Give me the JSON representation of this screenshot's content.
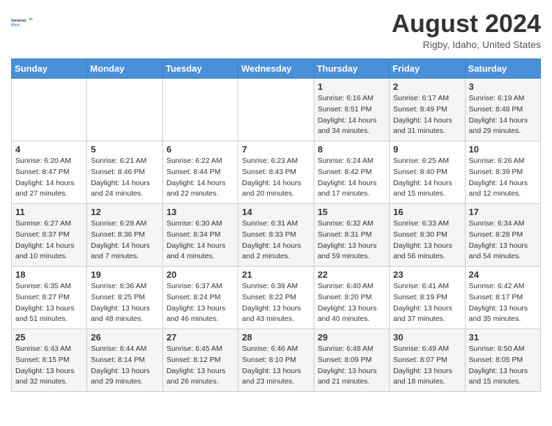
{
  "logo": {
    "text_general": "General",
    "text_blue": "Blue"
  },
  "title": {
    "month_year": "August 2024",
    "location": "Rigby, Idaho, United States"
  },
  "headers": [
    "Sunday",
    "Monday",
    "Tuesday",
    "Wednesday",
    "Thursday",
    "Friday",
    "Saturday"
  ],
  "weeks": [
    [
      {
        "day": "",
        "sunrise": "",
        "sunset": "",
        "daylight": ""
      },
      {
        "day": "",
        "sunrise": "",
        "sunset": "",
        "daylight": ""
      },
      {
        "day": "",
        "sunrise": "",
        "sunset": "",
        "daylight": ""
      },
      {
        "day": "",
        "sunrise": "",
        "sunset": "",
        "daylight": ""
      },
      {
        "day": "1",
        "sunrise": "Sunrise: 6:16 AM",
        "sunset": "Sunset: 8:51 PM",
        "daylight": "Daylight: 14 hours and 34 minutes."
      },
      {
        "day": "2",
        "sunrise": "Sunrise: 6:17 AM",
        "sunset": "Sunset: 8:49 PM",
        "daylight": "Daylight: 14 hours and 31 minutes."
      },
      {
        "day": "3",
        "sunrise": "Sunrise: 6:19 AM",
        "sunset": "Sunset: 8:48 PM",
        "daylight": "Daylight: 14 hours and 29 minutes."
      }
    ],
    [
      {
        "day": "4",
        "sunrise": "Sunrise: 6:20 AM",
        "sunset": "Sunset: 8:47 PM",
        "daylight": "Daylight: 14 hours and 27 minutes."
      },
      {
        "day": "5",
        "sunrise": "Sunrise: 6:21 AM",
        "sunset": "Sunset: 8:46 PM",
        "daylight": "Daylight: 14 hours and 24 minutes."
      },
      {
        "day": "6",
        "sunrise": "Sunrise: 6:22 AM",
        "sunset": "Sunset: 8:44 PM",
        "daylight": "Daylight: 14 hours and 22 minutes."
      },
      {
        "day": "7",
        "sunrise": "Sunrise: 6:23 AM",
        "sunset": "Sunset: 8:43 PM",
        "daylight": "Daylight: 14 hours and 20 minutes."
      },
      {
        "day": "8",
        "sunrise": "Sunrise: 6:24 AM",
        "sunset": "Sunset: 8:42 PM",
        "daylight": "Daylight: 14 hours and 17 minutes."
      },
      {
        "day": "9",
        "sunrise": "Sunrise: 6:25 AM",
        "sunset": "Sunset: 8:40 PM",
        "daylight": "Daylight: 14 hours and 15 minutes."
      },
      {
        "day": "10",
        "sunrise": "Sunrise: 6:26 AM",
        "sunset": "Sunset: 8:39 PM",
        "daylight": "Daylight: 14 hours and 12 minutes."
      }
    ],
    [
      {
        "day": "11",
        "sunrise": "Sunrise: 6:27 AM",
        "sunset": "Sunset: 8:37 PM",
        "daylight": "Daylight: 14 hours and 10 minutes."
      },
      {
        "day": "12",
        "sunrise": "Sunrise: 6:28 AM",
        "sunset": "Sunset: 8:36 PM",
        "daylight": "Daylight: 14 hours and 7 minutes."
      },
      {
        "day": "13",
        "sunrise": "Sunrise: 6:30 AM",
        "sunset": "Sunset: 8:34 PM",
        "daylight": "Daylight: 14 hours and 4 minutes."
      },
      {
        "day": "14",
        "sunrise": "Sunrise: 6:31 AM",
        "sunset": "Sunset: 8:33 PM",
        "daylight": "Daylight: 14 hours and 2 minutes."
      },
      {
        "day": "15",
        "sunrise": "Sunrise: 6:32 AM",
        "sunset": "Sunset: 8:31 PM",
        "daylight": "Daylight: 13 hours and 59 minutes."
      },
      {
        "day": "16",
        "sunrise": "Sunrise: 6:33 AM",
        "sunset": "Sunset: 8:30 PM",
        "daylight": "Daylight: 13 hours and 56 minutes."
      },
      {
        "day": "17",
        "sunrise": "Sunrise: 6:34 AM",
        "sunset": "Sunset: 8:28 PM",
        "daylight": "Daylight: 13 hours and 54 minutes."
      }
    ],
    [
      {
        "day": "18",
        "sunrise": "Sunrise: 6:35 AM",
        "sunset": "Sunset: 8:27 PM",
        "daylight": "Daylight: 13 hours and 51 minutes."
      },
      {
        "day": "19",
        "sunrise": "Sunrise: 6:36 AM",
        "sunset": "Sunset: 8:25 PM",
        "daylight": "Daylight: 13 hours and 48 minutes."
      },
      {
        "day": "20",
        "sunrise": "Sunrise: 6:37 AM",
        "sunset": "Sunset: 8:24 PM",
        "daylight": "Daylight: 13 hours and 46 minutes."
      },
      {
        "day": "21",
        "sunrise": "Sunrise: 6:39 AM",
        "sunset": "Sunset: 8:22 PM",
        "daylight": "Daylight: 13 hours and 43 minutes."
      },
      {
        "day": "22",
        "sunrise": "Sunrise: 6:40 AM",
        "sunset": "Sunset: 8:20 PM",
        "daylight": "Daylight: 13 hours and 40 minutes."
      },
      {
        "day": "23",
        "sunrise": "Sunrise: 6:41 AM",
        "sunset": "Sunset: 8:19 PM",
        "daylight": "Daylight: 13 hours and 37 minutes."
      },
      {
        "day": "24",
        "sunrise": "Sunrise: 6:42 AM",
        "sunset": "Sunset: 8:17 PM",
        "daylight": "Daylight: 13 hours and 35 minutes."
      }
    ],
    [
      {
        "day": "25",
        "sunrise": "Sunrise: 6:43 AM",
        "sunset": "Sunset: 8:15 PM",
        "daylight": "Daylight: 13 hours and 32 minutes."
      },
      {
        "day": "26",
        "sunrise": "Sunrise: 6:44 AM",
        "sunset": "Sunset: 8:14 PM",
        "daylight": "Daylight: 13 hours and 29 minutes."
      },
      {
        "day": "27",
        "sunrise": "Sunrise: 6:45 AM",
        "sunset": "Sunset: 8:12 PM",
        "daylight": "Daylight: 13 hours and 26 minutes."
      },
      {
        "day": "28",
        "sunrise": "Sunrise: 6:46 AM",
        "sunset": "Sunset: 8:10 PM",
        "daylight": "Daylight: 13 hours and 23 minutes."
      },
      {
        "day": "29",
        "sunrise": "Sunrise: 6:48 AM",
        "sunset": "Sunset: 8:09 PM",
        "daylight": "Daylight: 13 hours and 21 minutes."
      },
      {
        "day": "30",
        "sunrise": "Sunrise: 6:49 AM",
        "sunset": "Sunset: 8:07 PM",
        "daylight": "Daylight: 13 hours and 18 minutes."
      },
      {
        "day": "31",
        "sunrise": "Sunrise: 6:50 AM",
        "sunset": "Sunset: 8:05 PM",
        "daylight": "Daylight: 13 hours and 15 minutes."
      }
    ]
  ]
}
